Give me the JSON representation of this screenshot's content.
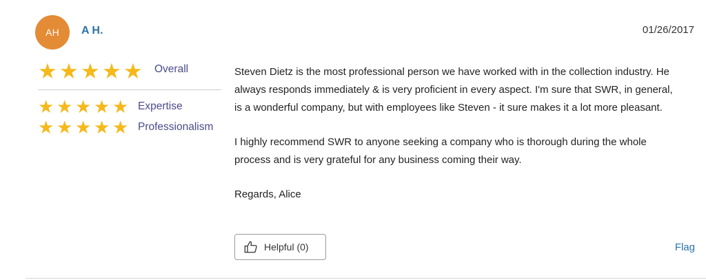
{
  "reviewer": {
    "initials": "AH",
    "name": "A H."
  },
  "review": {
    "date": "01/26/2017",
    "paragraphs": [
      "Steven Dietz is the most professional person we have worked with in the collection industry. He always responds immediately & is very proficient in every aspect. I'm sure that SWR, in general, is a wonderful company, but with employees like Steven - it sure makes it a lot more pleasant.",
      "I highly recommend SWR to anyone seeking a company who is thorough during the whole process and is very grateful for any business coming their way.",
      "Regards, Alice"
    ]
  },
  "ratings": {
    "overall": {
      "label": "Overall",
      "stars": 5,
      "max": 5
    },
    "expertise": {
      "label": "Expertise",
      "stars": 5,
      "max": 5
    },
    "professionalism": {
      "label": "Professionalism",
      "stars": 5,
      "max": 5
    }
  },
  "actions": {
    "helpful_label": "Helpful (0)",
    "flag_label": "Flag"
  },
  "colors": {
    "avatar_bg": "#e48b35",
    "star": "#f5b91b",
    "link": "#2a72a8",
    "rating_label": "#4a4a8c"
  },
  "icons": {
    "star": "star-icon",
    "helpful": "thumbs-up-icon"
  }
}
